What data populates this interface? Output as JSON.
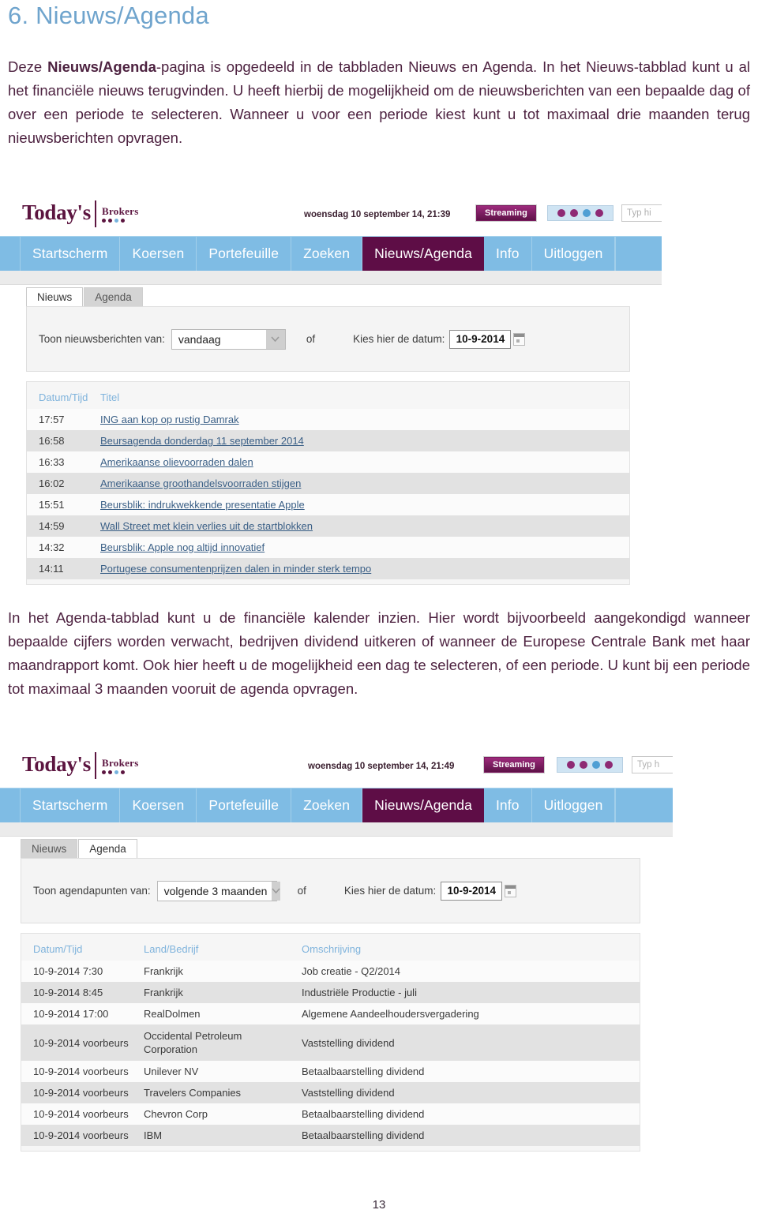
{
  "document": {
    "heading": "6. Nieuws/Agenda",
    "paragraph1_prefix": "Deze ",
    "paragraph1_bold": "Nieuws/Agenda",
    "paragraph1_rest": "-pagina is opgedeeld in de tabbladen Nieuws en Agenda. In het Nieuws-tabblad kunt u al het financiële nieuws terugvinden. U heeft hierbij de mogelijkheid om de nieuwsberichten van een bepaalde dag of over een periode te selecteren. Wanneer u voor een periode kiest kunt u tot maximaal drie maanden terug nieuwsberichten opvragen.",
    "paragraph2": "In het Agenda-tabblad kunt u de financiële kalender inzien. Hier wordt bijvoorbeeld aangekondigd wanneer bepaalde cijfers worden verwacht, bedrijven dividend uitkeren of wanneer de Europese Centrale Bank met haar maandrapport komt. Ook hier heeft u de mogelijkheid een dag te selecteren, of een periode. U kunt bij een periode tot maximaal 3 maanden vooruit de agenda opvragen.",
    "page_number": "13"
  },
  "colors": {
    "heading_blue": "#6fa4cd",
    "body_purple": "#4d2240",
    "brand_purple": "#5c1540",
    "nav_blue": "#7fbce4",
    "nav_active": "#5e0d46",
    "table_header_blue": "#7fb3dc",
    "link_blue": "#3a5f86"
  },
  "screenshot_news": {
    "logo": {
      "primary": "Today's",
      "secondary": "Brokers",
      "dots": [
        "purple",
        "purple",
        "blue",
        "purple"
      ]
    },
    "header": {
      "datetime": "woensdag 10 september 14, 21:39",
      "streaming_label": "Streaming",
      "indicator_dots": [
        "purple",
        "purple",
        "lightblue",
        "purple"
      ],
      "search_placeholder": "Typ hi"
    },
    "nav": {
      "items": [
        {
          "label": "Startscherm",
          "active": false
        },
        {
          "label": "Koersen",
          "active": false
        },
        {
          "label": "Portefeuille",
          "active": false
        },
        {
          "label": "Zoeken",
          "active": false
        },
        {
          "label": "Nieuws/Agenda",
          "active": true
        },
        {
          "label": "Info",
          "active": false
        },
        {
          "label": "Uitloggen",
          "active": false
        }
      ]
    },
    "subtabs": [
      {
        "label": "Nieuws",
        "active": true
      },
      {
        "label": "Agenda",
        "active": false
      }
    ],
    "filter": {
      "label": "Toon nieuwsberichten van:",
      "select_value": "vandaag",
      "of": "of",
      "date_label": "Kies hier de datum:",
      "date_value": "10-9-2014"
    },
    "table": {
      "headers": [
        "Datum/Tijd",
        "Titel"
      ],
      "rows": [
        {
          "time": "17:57",
          "title": "ING aan kop op rustig Damrak"
        },
        {
          "time": "16:58",
          "title": "Beursagenda donderdag 11 september 2014"
        },
        {
          "time": "16:33",
          "title": "Amerikaanse olievoorraden dalen"
        },
        {
          "time": "16:02",
          "title": "Amerikaanse groothandelsvoorraden stijgen"
        },
        {
          "time": "15:51",
          "title": "Beursblik: indrukwekkende presentatie Apple"
        },
        {
          "time": "14:59",
          "title": "Wall Street met klein verlies uit de startblokken"
        },
        {
          "time": "14:32",
          "title": "Beursblik: Apple nog altijd innovatief"
        },
        {
          "time": "14:11",
          "title": "Portugese consumentenprijzen dalen in minder sterk tempo"
        }
      ]
    }
  },
  "screenshot_agenda": {
    "logo": {
      "primary": "Today's",
      "secondary": "Brokers",
      "dots": [
        "purple",
        "purple",
        "blue",
        "purple"
      ]
    },
    "header": {
      "datetime": "woensdag 10 september 14, 21:49",
      "streaming_label": "Streaming",
      "indicator_dots": [
        "purple",
        "purple",
        "lightblue",
        "purple"
      ],
      "search_placeholder": "Typ h"
    },
    "nav": {
      "items": [
        {
          "label": "Startscherm",
          "active": false
        },
        {
          "label": "Koersen",
          "active": false
        },
        {
          "label": "Portefeuille",
          "active": false
        },
        {
          "label": "Zoeken",
          "active": false
        },
        {
          "label": "Nieuws/Agenda",
          "active": true
        },
        {
          "label": "Info",
          "active": false
        },
        {
          "label": "Uitloggen",
          "active": false
        }
      ]
    },
    "subtabs": [
      {
        "label": "Nieuws",
        "active": false
      },
      {
        "label": "Agenda",
        "active": true
      }
    ],
    "filter": {
      "label": "Toon agendapunten van:",
      "select_value": "volgende 3 maanden",
      "of": "of",
      "date_label": "Kies hier de datum:",
      "date_value": "10-9-2014"
    },
    "table": {
      "headers": [
        "Datum/Tijd",
        "Land/Bedrijf",
        "Omschrijving"
      ],
      "rows": [
        {
          "datetime": "10-9-2014 7:30",
          "company": "Frankrijk",
          "description": "Job creatie - Q2/2014"
        },
        {
          "datetime": "10-9-2014 8:45",
          "company": "Frankrijk",
          "description": "Industriële Productie - juli"
        },
        {
          "datetime": "10-9-2014 17:00",
          "company": "RealDolmen",
          "description": "Algemene Aandeelhoudersvergadering"
        },
        {
          "datetime": "10-9-2014 voorbeurs",
          "company": "Occidental Petroleum Corporation",
          "description": "Vaststelling dividend"
        },
        {
          "datetime": "10-9-2014 voorbeurs",
          "company": "Unilever NV",
          "description": "Betaalbaarstelling dividend"
        },
        {
          "datetime": "10-9-2014 voorbeurs",
          "company": "Travelers Companies",
          "description": "Vaststelling dividend"
        },
        {
          "datetime": "10-9-2014 voorbeurs",
          "company": "Chevron Corp",
          "description": "Betaalbaarstelling dividend"
        },
        {
          "datetime": "10-9-2014 voorbeurs",
          "company": "IBM",
          "description": "Betaalbaarstelling dividend"
        }
      ]
    }
  }
}
